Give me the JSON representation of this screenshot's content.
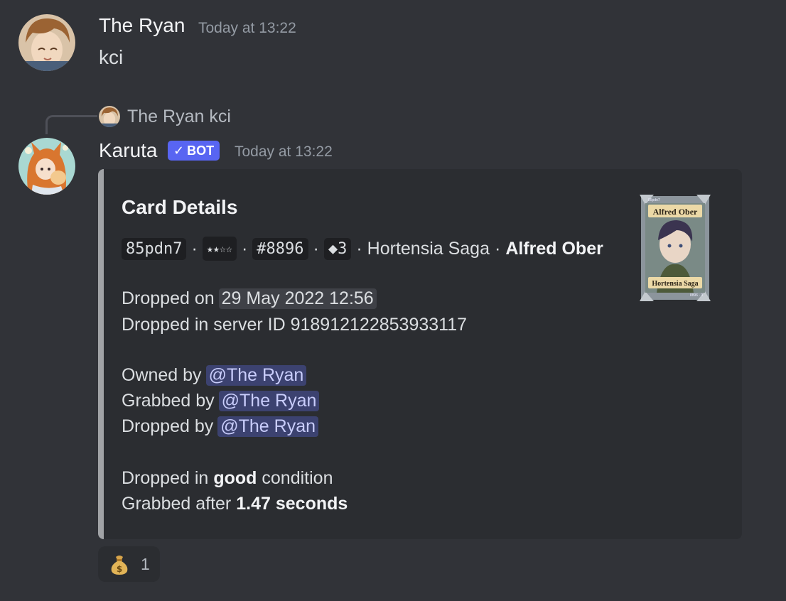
{
  "message1": {
    "author": "The Ryan",
    "timestamp": "Today at 13:22",
    "content": "kci"
  },
  "reply": {
    "author": "The Ryan",
    "content": "kci"
  },
  "message2": {
    "author": "Karuta",
    "badge": "BOT",
    "timestamp": "Today at 13:22"
  },
  "embed": {
    "title": "Card Details",
    "code": "85pdn7",
    "stars": "★★☆☆",
    "print": "#8896",
    "edition": "◆3",
    "series": "Hortensia Saga",
    "character": "Alfred Ober",
    "dropped_on_label": "Dropped on",
    "dropped_on_value": "29 May 2022 12:56",
    "server_line": "Dropped in server ID 918912122853933117",
    "owned_label": "Owned by",
    "grabbed_label": "Grabbed by",
    "dropped_by_label": "Dropped by",
    "mention": "@The Ryan",
    "condition_prefix": "Dropped in",
    "condition_value": "good",
    "condition_suffix": "condition",
    "grab_prefix": "Grabbed after",
    "grab_value": "1.47 seconds",
    "card_image": {
      "name_banner": "Alfred Ober",
      "series_banner": "Hortensia Saga",
      "corner_code": "85pdn7",
      "corner_print": "8896 · 3"
    }
  },
  "reaction": {
    "emoji": "money-bag",
    "count": "1"
  },
  "colors": {
    "background": "#313338",
    "embed_background": "#2b2d31",
    "embed_border": "#a1a3a6",
    "bot_badge": "#5865f2",
    "mention_background": "#3c4270"
  }
}
